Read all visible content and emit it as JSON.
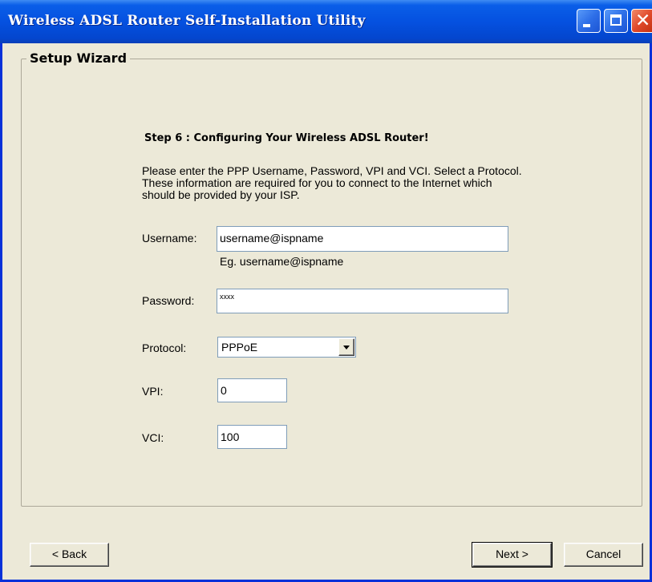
{
  "window": {
    "title": "Wireless ADSL Router Self-Installation Utility",
    "controls": [
      "minimize-icon",
      "maximize-icon",
      "close-icon"
    ]
  },
  "wizard": {
    "group_title": "Setup Wizard",
    "step_title": "Step 6 : Configuring Your Wireless ADSL Router!",
    "description": "Please enter the PPP Username, Password, VPI and VCI. Select a Protocol. These information are required for you to connect to the Internet which should be provided by your ISP."
  },
  "form": {
    "username_label": "Username:",
    "username_value": "username@ispname",
    "username_hint": "Eg. username@ispname",
    "password_label": "Password:",
    "password_value": "xxxx",
    "protocol_label": "Protocol:",
    "protocol_value": "PPPoE",
    "vpi_label": "VPI:",
    "vpi_value": "0",
    "vci_label": "VCI:",
    "vci_value": "100"
  },
  "buttons": {
    "back": "< Back",
    "next": "Next >",
    "cancel": "Cancel"
  }
}
